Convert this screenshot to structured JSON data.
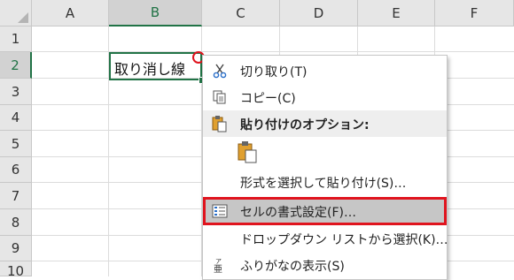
{
  "grid": {
    "columns": [
      "A",
      "B",
      "C",
      "D",
      "E",
      "F"
    ],
    "rows": [
      "1",
      "2",
      "3",
      "4",
      "5",
      "6",
      "7",
      "8",
      "9",
      "10"
    ],
    "selected_column": "B",
    "selected_row": "2",
    "active_cell_text": "取り消し線"
  },
  "context_menu": {
    "cut": "切り取り(T)",
    "copy": "コピー(C)",
    "paste_options_header": "貼り付けのオプション:",
    "paste_special": "形式を選択して貼り付け(S)…",
    "format_cells": "セルの書式設定(F)…",
    "dropdown_list": "ドロップダウン リストから選択(K)…",
    "phonetic": "ふりがなの表示(S)"
  },
  "colors": {
    "excel_green": "#217346",
    "highlight_red": "#e0141e",
    "menu_highlight": "#c6c6c6"
  }
}
